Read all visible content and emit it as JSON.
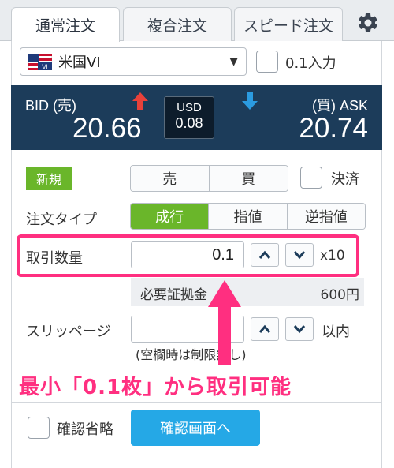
{
  "tabs": [
    {
      "label": "通常注文",
      "active": true
    },
    {
      "label": "複合注文",
      "active": false
    },
    {
      "label": "スピード注文",
      "active": false
    }
  ],
  "settings_icon": "gear-icon",
  "symbol": {
    "name": "米国VI",
    "flag_icon": "us-flag-icon",
    "flag_text": "VI"
  },
  "decimal_toggle_label": "0.1入力",
  "prices": {
    "bid_label": "BID (売)",
    "bid": "20.66",
    "ask_label": "(買) ASK",
    "ask": "20.74",
    "spread_currency": "USD",
    "spread": "0.08",
    "bid_arrow_color": "#e8413a",
    "ask_arrow_color": "#2b9be0"
  },
  "order": {
    "new_badge": "新規",
    "sell": "売",
    "buy": "買",
    "settle_label": "決済",
    "type_label": "注文タイプ",
    "types": [
      {
        "label": "成行",
        "selected": true
      },
      {
        "label": "指値",
        "selected": false
      },
      {
        "label": "逆指値",
        "selected": false
      }
    ],
    "qty_label": "取引数量",
    "qty_value": "0.1",
    "qty_multiplier": "x10",
    "margin_label": "必要証拠金",
    "margin_value": "600円",
    "slippage_label": "スリッページ",
    "slippage_value": "",
    "slippage_unit": "以内",
    "slippage_note": "(空欄時は制限無し)"
  },
  "annotation": {
    "text": "最小「0.1枚」から取引可能",
    "color": "#ff2f80"
  },
  "footer": {
    "skip_confirm_label": "確認省略",
    "confirm_button": "確認画面へ"
  },
  "colors": {
    "accent_green": "#6ab62a",
    "confirm_blue": "#25a8e6",
    "price_panel": "#1c3c5a"
  }
}
